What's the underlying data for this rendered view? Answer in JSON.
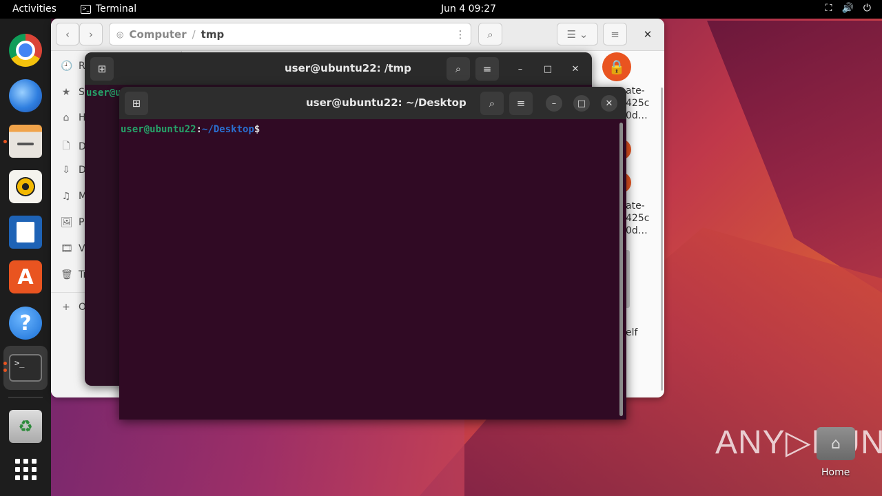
{
  "topbar": {
    "activities": "Activities",
    "app_name": "Terminal",
    "clock": "Jun 4  09:27",
    "tray": {
      "network": "⛶",
      "volume": "🔊",
      "power": "⏻"
    }
  },
  "dock": {
    "apps": [
      {
        "name": "chrome",
        "glyph": ""
      },
      {
        "name": "thunderbird",
        "glyph": ""
      },
      {
        "name": "files",
        "glyph": ""
      },
      {
        "name": "rhythmbox",
        "glyph": ""
      },
      {
        "name": "libreoffice-writer",
        "glyph": ""
      },
      {
        "name": "app-center",
        "glyph": "A"
      },
      {
        "name": "help",
        "glyph": "?"
      },
      {
        "name": "terminal",
        "glyph": ">_"
      },
      {
        "name": "trash",
        "glyph": "♻"
      }
    ]
  },
  "file_manager": {
    "path": {
      "root": "Computer",
      "separator": "/",
      "current": "tmp"
    },
    "nav": {
      "back": "‹",
      "forward": "›"
    },
    "sidebar": [
      {
        "icon": "🕘",
        "label": "R"
      },
      {
        "icon": "★",
        "label": "S"
      },
      {
        "icon": "⌂",
        "label": "H"
      },
      {
        "icon": "🗋",
        "label": "D"
      },
      {
        "icon": "⇩",
        "label": "D"
      },
      {
        "icon": "♫",
        "label": "M"
      },
      {
        "icon": "🖼",
        "label": "P"
      },
      {
        "icon": "🎞",
        "label": "V"
      },
      {
        "icon": "🗑",
        "label": "Tr"
      },
      {
        "icon": "+",
        "label": "O"
      }
    ],
    "right_texts": [
      "ate-",
      "425c",
      "0d…",
      "ate-",
      "425c",
      "0d…",
      "elf"
    ]
  },
  "terminal_back": {
    "title": "user@ubuntu22: /tmp",
    "prompt_fragment": "user@u"
  },
  "terminal_front": {
    "title": "user@ubuntu22: ~/Desktop",
    "prompt_user": "user@ubuntu22",
    "prompt_colon": ":",
    "prompt_path": "~/Desktop",
    "prompt_dollar": "$"
  },
  "desktop": {
    "home_label": "Home",
    "watermark": "ANY▷RUN"
  }
}
